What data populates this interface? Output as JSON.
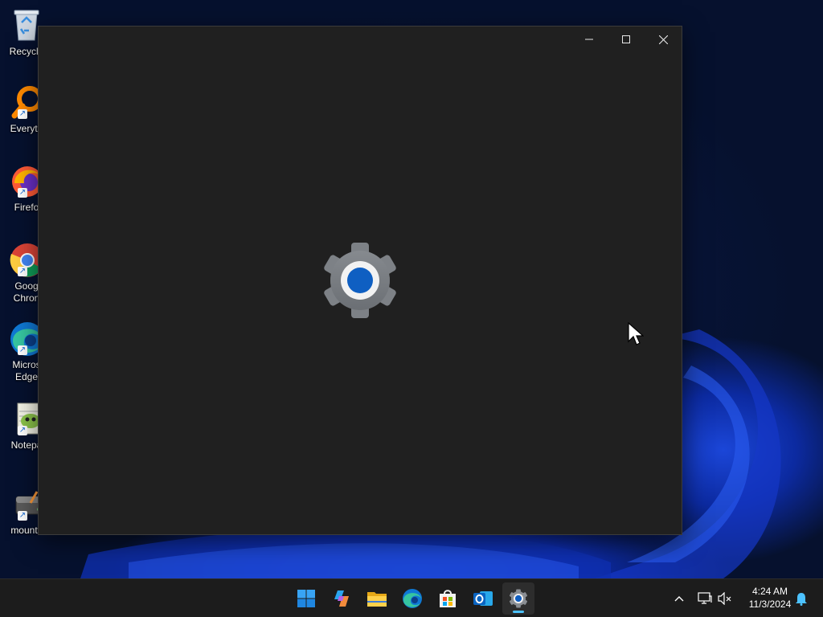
{
  "desktop": {
    "icons": [
      {
        "label": "Recycle",
        "icon": "recycle-bin-icon"
      },
      {
        "label": "Everyth",
        "icon": "everything-search-icon"
      },
      {
        "label": "Firefo",
        "icon": "firefox-icon"
      },
      {
        "label": "Goog\nChron",
        "icon": "chrome-icon"
      },
      {
        "label": "Micros\nEdge",
        "icon": "edge-icon"
      },
      {
        "label": "Notepa",
        "icon": "notepad-plus-plus-icon"
      },
      {
        "label": "mountv",
        "icon": "mountvol-icon"
      }
    ]
  },
  "window": {
    "app": "Settings",
    "state": "loading",
    "splash_icon": "settings-gear-icon",
    "caption_buttons": [
      "minimize",
      "maximize",
      "close"
    ]
  },
  "taskbar": {
    "apps": [
      {
        "name": "Start",
        "icon": "windows-start-icon",
        "active": false
      },
      {
        "name": "Copilot",
        "icon": "copilot-icon",
        "active": false
      },
      {
        "name": "File Explorer",
        "icon": "file-explorer-icon",
        "active": false
      },
      {
        "name": "Microsoft Edge",
        "icon": "edge-icon",
        "active": false
      },
      {
        "name": "Microsoft Store",
        "icon": "store-icon",
        "active": false
      },
      {
        "name": "Outlook",
        "icon": "outlook-icon",
        "active": false
      },
      {
        "name": "Settings",
        "icon": "settings-gear-icon",
        "active": true
      }
    ],
    "tray": {
      "time": "4:24 AM",
      "date": "11/3/2024"
    }
  },
  "colors": {
    "accent": "#4cc2ff",
    "window_bg": "#202020",
    "taskbar_bg": "#1c1c1c"
  }
}
